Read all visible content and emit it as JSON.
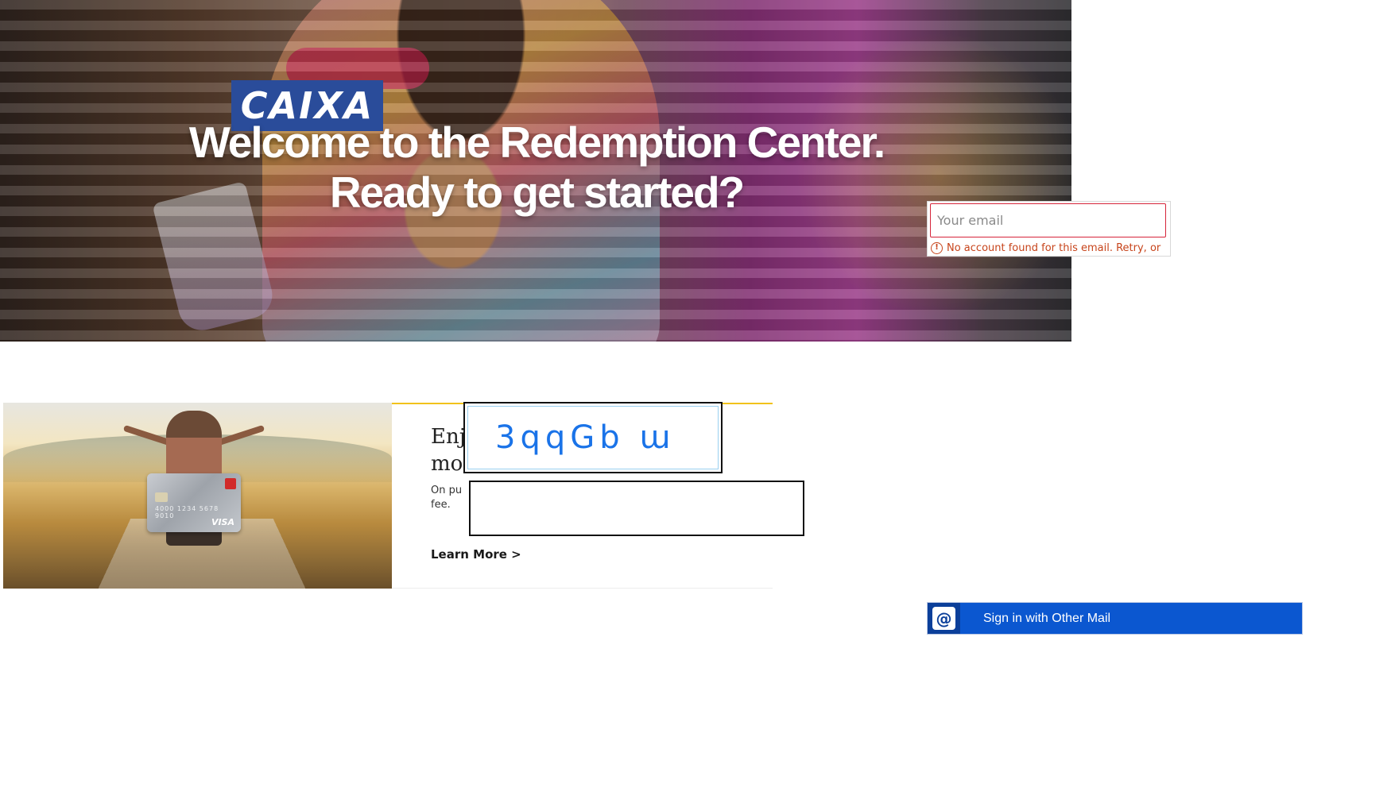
{
  "hero": {
    "logo_text": "CAIXA",
    "title_line1": "Welcome to the Redemption Center.",
    "title_line2": "Ready to get started?"
  },
  "login": {
    "email_placeholder": "Your email",
    "email_value": "",
    "error_text": "No account found for this email. Retry, or"
  },
  "promo": {
    "heading_line1": "Enj",
    "heading_line2": "mo",
    "body_line1": "On pu",
    "body_line2": "fee.",
    "link_label": "Learn More >",
    "card_number": "4000 1234 5678 9010",
    "card_brand": "VISA"
  },
  "captcha": {
    "text": "3qqGb ɯ",
    "input_value": ""
  },
  "signin": {
    "icon_glyph": "@",
    "label": "Sign in with Other Mail"
  },
  "colors": {
    "primary_button": "#0b57d0",
    "error": "#c7441b",
    "logo_bg": "#2a4c9a",
    "promo_rule": "#f1c21b",
    "captcha_text": "#1a73e8"
  },
  "icons": {
    "error": "alert-circle-icon",
    "signin": "at-sign-icon"
  }
}
